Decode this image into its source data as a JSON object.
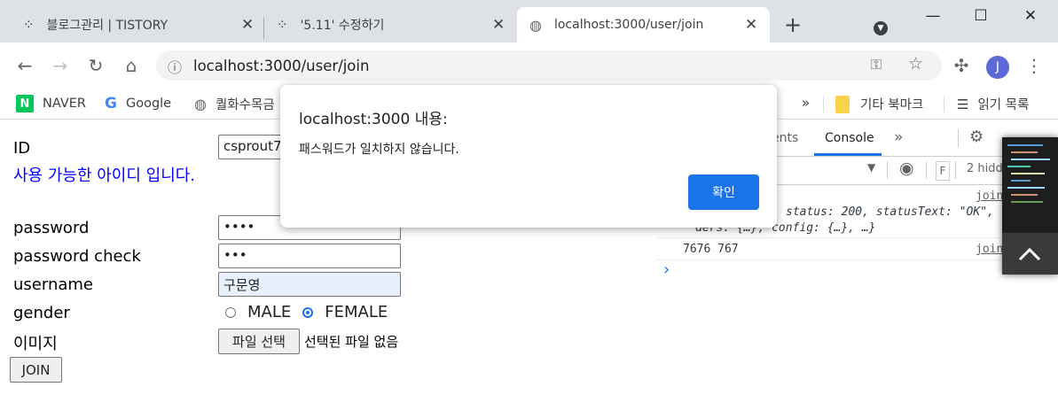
{
  "browser": {
    "tabs": [
      {
        "title": "블로그관리 | TISTORY",
        "icon": "tistory-icon"
      },
      {
        "title": "'5.11' 수정하기",
        "icon": "tistory-icon"
      },
      {
        "title": "localhost:3000/user/join",
        "icon": "globe-icon",
        "active": true
      }
    ],
    "new_tab": "+",
    "url": "localhost:3000/user/join",
    "avatar_letter": "J",
    "bookmarks": [
      {
        "label": "NAVER",
        "icon": "naver-icon"
      },
      {
        "label": "Google",
        "icon": "google-icon"
      },
      {
        "label": "퀄화수목금",
        "icon": "globe-icon"
      }
    ],
    "bookmarks_overflow": "»",
    "other_bookmarks": "기타 북마크",
    "reading_list": "읽기 목록"
  },
  "form": {
    "id_label": "ID",
    "id_value": "csprout7",
    "id_available_msg": "사용 가능한 아이디 입니다.",
    "password_label": "password",
    "password_value": "••••",
    "password_check_label": "password check",
    "password_check_value": "•••",
    "username_label": "username",
    "username_value": "구문영",
    "gender_label": "gender",
    "gender_options": [
      "MALE",
      "FEMALE"
    ],
    "gender_selected": "FEMALE",
    "image_label": "이미지",
    "file_button": "파일 선택",
    "file_status": "선택된 파일 없음",
    "join_button": "JOIN"
  },
  "devtools": {
    "tabs": [
      "ents",
      "Console"
    ],
    "more": "»",
    "filter_placeholder": "F",
    "hidden_count": "2 hidd",
    "log_lines": [
      {
        "text": "status: 200, statusText: \"OK\",",
        "source": "join"
      },
      {
        "text": "ders: {…}, config: {…}, …}",
        "source": ""
      },
      {
        "text": "7676 767",
        "source": "join"
      }
    ],
    "prompt": "›"
  },
  "dialog": {
    "title": "localhost:3000 내용:",
    "message": "패스워드가 일치하지 않습니다.",
    "ok_button": "확인"
  },
  "colors": {
    "accent": "#1a73e8",
    "available_msg": "#0000ff",
    "tabstrip": "#dee1e6"
  }
}
